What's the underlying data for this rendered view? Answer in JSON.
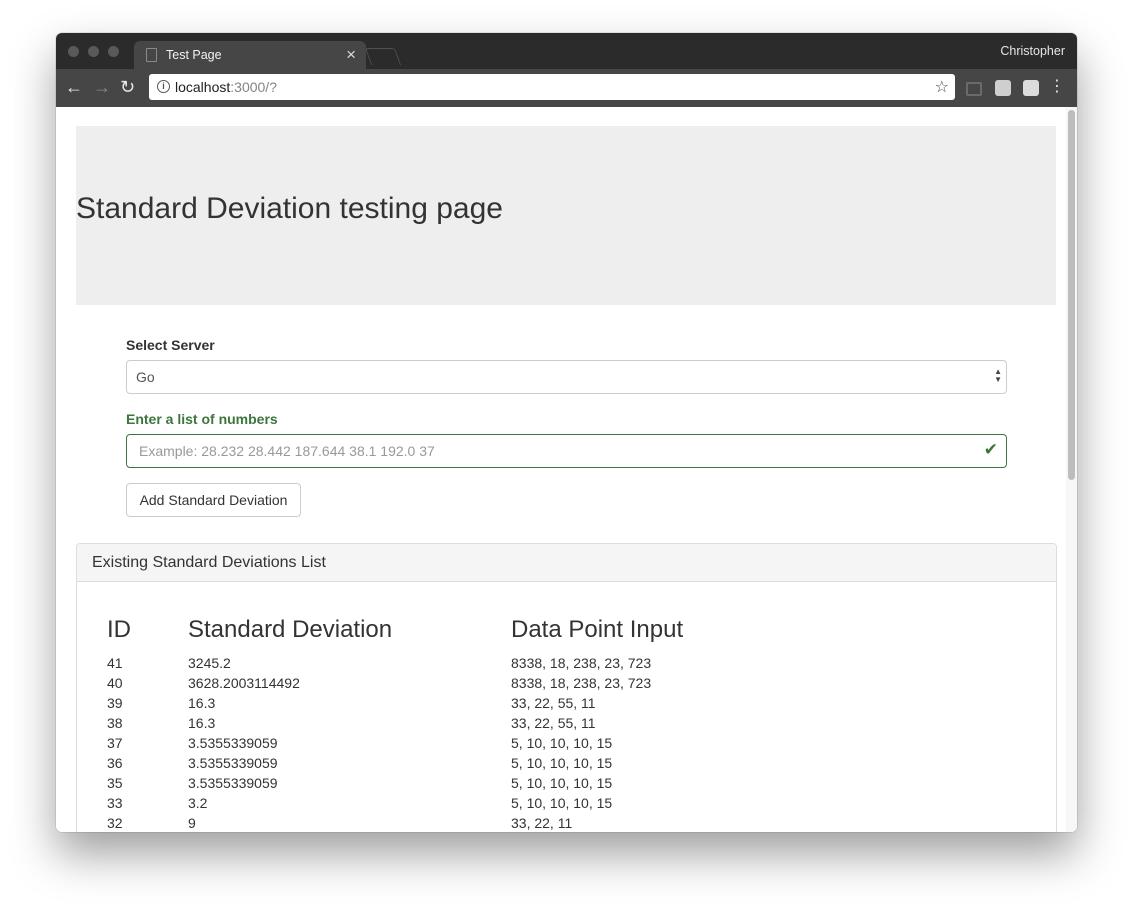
{
  "browser": {
    "tab_title": "Test Page",
    "profile_name": "Christopher",
    "url_host": "localhost",
    "url_path": ":3000/?",
    "icons": [
      "back-icon",
      "forward-icon",
      "reload-icon",
      "info-icon",
      "star-icon",
      "cast-icon",
      "extension-icon",
      "menu-icon"
    ]
  },
  "page": {
    "title": "Standard Deviation testing page",
    "select_label": "Select Server",
    "select_value": "Go",
    "numbers_label": "Enter a list of numbers",
    "numbers_placeholder": "Example: 28.232 28.442 187.644 38.1 192.0 37",
    "add_button": "Add Standard Deviation",
    "colors": {
      "success": "#3c763d",
      "jumbotron": "#eeeeee"
    }
  },
  "panel": {
    "heading": "Existing Standard Deviations List",
    "columns": [
      "ID",
      "Standard Deviation",
      "Data Point Input"
    ],
    "rows": [
      {
        "id": "41",
        "sd": "3245.2",
        "input": "8338, 18, 238, 23, 723"
      },
      {
        "id": "40",
        "sd": "3628.2003114492",
        "input": "8338, 18, 238, 23, 723"
      },
      {
        "id": "39",
        "sd": "16.3",
        "input": "33, 22, 55, 11"
      },
      {
        "id": "38",
        "sd": "16.3",
        "input": "33, 22, 55, 11"
      },
      {
        "id": "37",
        "sd": "3.5355339059",
        "input": "5, 10, 10, 10, 15"
      },
      {
        "id": "36",
        "sd": "3.5355339059",
        "input": "5, 10, 10, 10, 15"
      },
      {
        "id": "35",
        "sd": "3.5355339059",
        "input": "5, 10, 10, 10, 15"
      },
      {
        "id": "33",
        "sd": "3.2",
        "input": "5, 10, 10, 10, 15"
      },
      {
        "id": "32",
        "sd": "9",
        "input": "33, 22, 11"
      }
    ]
  }
}
